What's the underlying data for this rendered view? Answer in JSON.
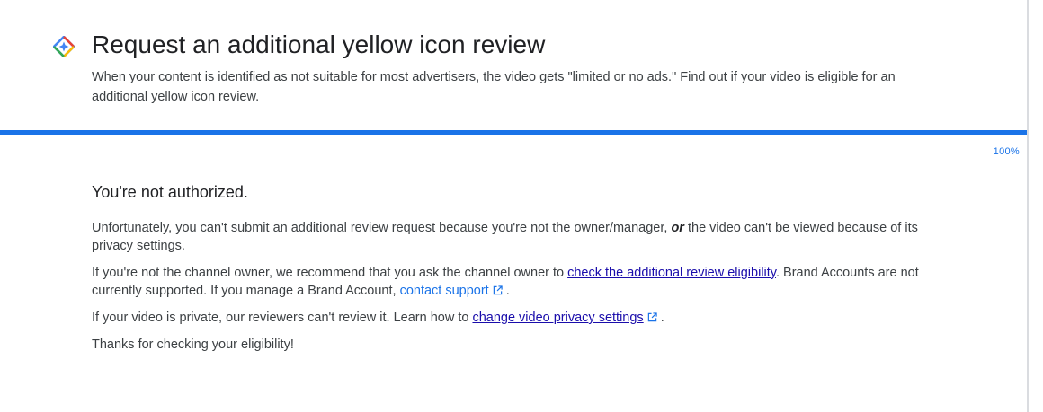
{
  "header": {
    "logo_icon": "google-help-diamond-icon",
    "title": "Request an additional yellow icon review",
    "subtitle": "When your content is identified as not suitable for most advertisers, the video gets \"limited or no ads.\" Find out if your video is eligible for an additional yellow icon review."
  },
  "progress": {
    "value": 100,
    "label": "100%",
    "color": "#1a73e8"
  },
  "content": {
    "heading": "You're not authorized.",
    "p1": {
      "before": "Unfortunately, you can't submit an additional review request because you're not the owner/manager, ",
      "emphasis": "or",
      "after": " the video can't be viewed because of its privacy settings."
    },
    "p2": {
      "before": "If you're not the channel owner, we recommend that you ask the channel owner to ",
      "link1": "check the additional review eligibility",
      "middle": ". Brand Accounts are not currently supported. If you manage a Brand Account, ",
      "link2": "contact support",
      "link2_icon": "external-link-icon",
      "after": " ."
    },
    "p3": {
      "before": "If your video is private, our reviewers can't review it. Learn how to ",
      "link": "change video privacy settings",
      "link_icon": "external-link-icon",
      "after": " ."
    },
    "p4": "Thanks for checking your eligibility!"
  }
}
